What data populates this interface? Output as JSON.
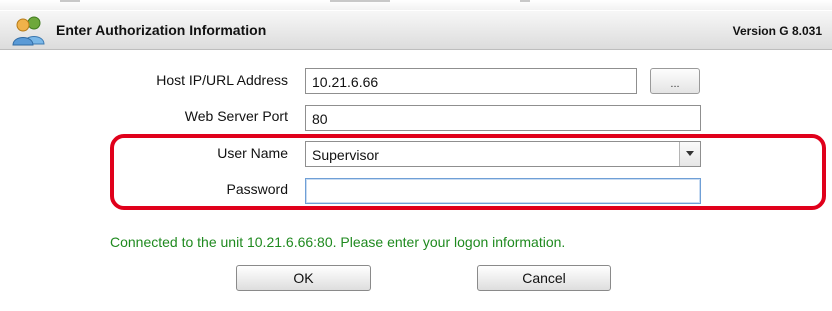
{
  "header": {
    "title": "Enter Authorization Information",
    "version": "Version G 8.031",
    "icon": "users-icon"
  },
  "form": {
    "host": {
      "label": "Host IP/URL Address",
      "value": "10.21.6.66",
      "browse_label": "..."
    },
    "port": {
      "label": "Web Server Port",
      "value": "80"
    },
    "user": {
      "label": "User Name",
      "selected": "Supervisor"
    },
    "password": {
      "label": "Password",
      "value": ""
    }
  },
  "status": {
    "message": "Connected to the unit 10.21.6.66:80. Please enter your logon information.",
    "color": "#1f8a1f"
  },
  "buttons": {
    "ok_label": "OK",
    "cancel_label": "Cancel"
  },
  "highlight": {
    "color": "#e0001b"
  }
}
